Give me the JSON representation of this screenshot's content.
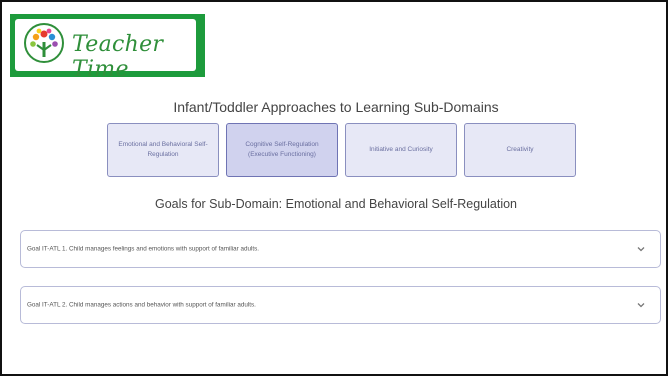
{
  "brand": {
    "name": "Teacher Time",
    "color": "#1d9b3c"
  },
  "page": {
    "heading": "Infant/Toddler Approaches to Learning Sub-Domains",
    "tabs": [
      {
        "label": "Emotional and Behavioral Self-Regulation",
        "selected": false
      },
      {
        "label": "Cognitive Self-Regulation (Executive Functioning)",
        "selected": true
      },
      {
        "label": "Initiative and Curiosity",
        "selected": false
      },
      {
        "label": "Creativity",
        "selected": false
      }
    ],
    "goals_heading": "Goals for Sub-Domain: Emotional and Behavioral Self-Regulation",
    "goals": [
      {
        "label": "Goal IT-ATL 1. Child manages feelings and emotions with support of familiar adults.",
        "icon": "chevron-down-icon"
      },
      {
        "label": "Goal IT-ATL 2. Child manages actions and behavior with support of familiar adults.",
        "icon": "chevron-down-icon"
      }
    ]
  }
}
